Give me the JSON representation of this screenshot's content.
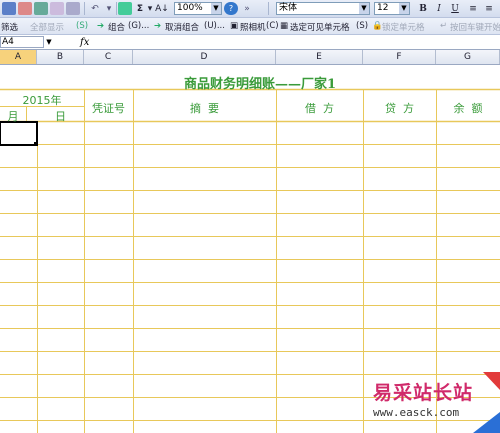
{
  "toolbar1": {
    "zoom": "100%",
    "font_name": "宋体",
    "font_size": "12",
    "bold": "B",
    "italic": "I",
    "underline": "U",
    "sum": "Σ",
    "sort": "A↓"
  },
  "toolbar2": {
    "filter": "筛选",
    "show_all": "全部显示",
    "group": "组合",
    "ungroup": "取消组合",
    "camera": "照相机",
    "select_visible": "选定可见单元格",
    "lock_cell": "锁定单元格",
    "enter_move": "按回车键开始"
  },
  "formula_bar": {
    "name_box": "A4",
    "fx": "fx",
    "value": ""
  },
  "columns": [
    "A",
    "B",
    "C",
    "D",
    "E",
    "F",
    "G"
  ],
  "sheet": {
    "title": "商品财务明细账——厂家1",
    "year": "2015年",
    "month": "月",
    "day": "日",
    "voucher": "凭证号",
    "summary": "摘  要",
    "debit": "借  方",
    "credit": "贷  方",
    "balance": "余  额"
  },
  "watermark": {
    "line1": "易采站长站",
    "line2": "www.easck.com"
  },
  "colors": {
    "grid_line": "#e8c85a",
    "header_text": "#3a9b3a",
    "selected_col": "#f7d27c"
  }
}
